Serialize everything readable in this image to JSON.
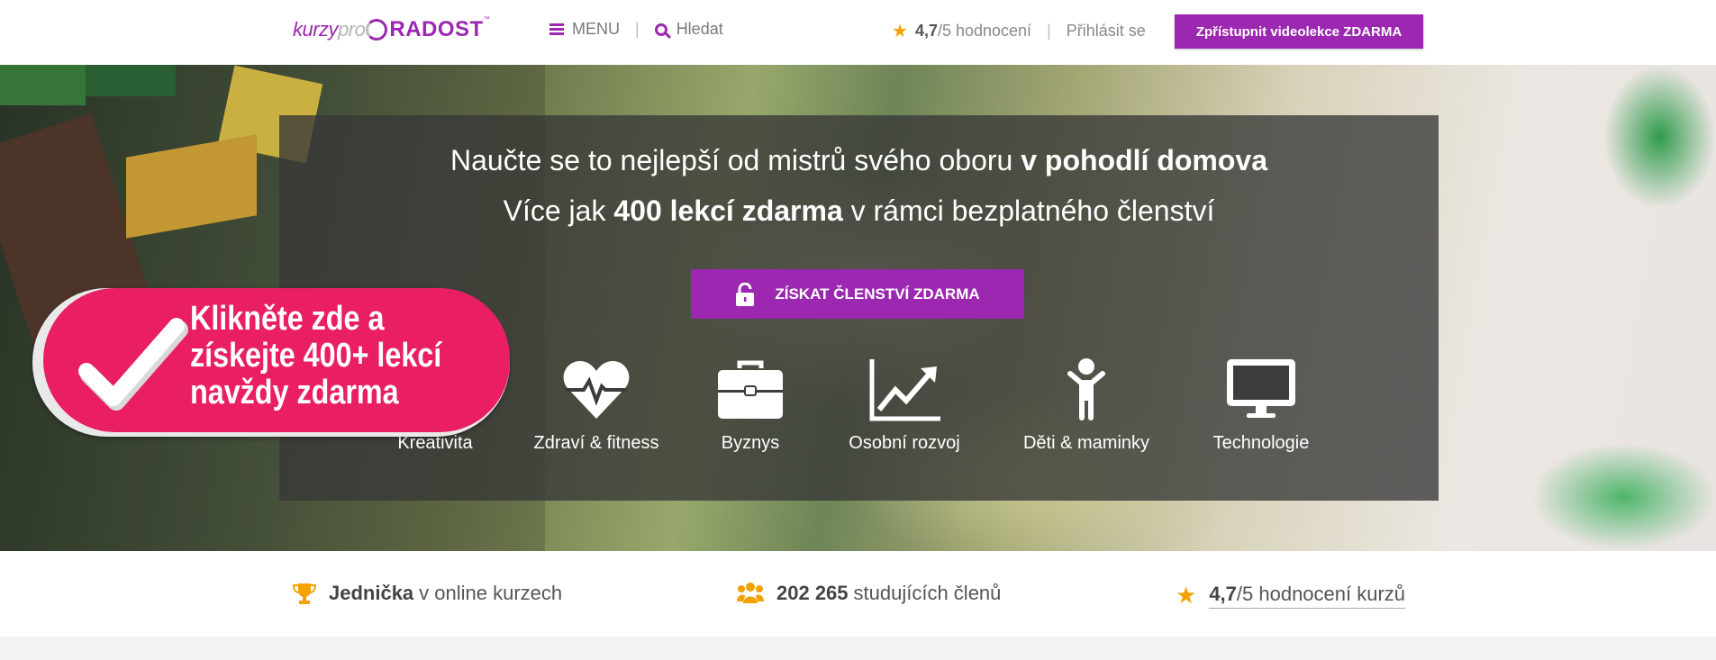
{
  "header": {
    "logo_part1": "kurzy",
    "logo_part2": "pro",
    "logo_part3": "RADOST",
    "logo_tm": "™",
    "menu_label": "MENU",
    "search_label": "Hledat",
    "rating_value": "4,7",
    "rating_suffix": "/5 hodnocení",
    "divider": "|",
    "login_label": "Přihlásit se",
    "cta_label": "Zpřístupnit videolekce ZDARMA"
  },
  "hero": {
    "line1_normal": "Naučte se to nejlepší od mistrů svého oboru ",
    "line1_bold": "v pohodlí domova",
    "line2_pre": "Více jak ",
    "line2_bold": "400 lekcí zdarma",
    "line2_post": " v rámci bezplatného členství",
    "cta_label": "ZÍSKAT ČLENSTVÍ ZDARMA",
    "categories": [
      {
        "label": "Kreativita",
        "icon": "brush-icon"
      },
      {
        "label": "Zdraví & fitness",
        "icon": "heartbeat-icon"
      },
      {
        "label": "Byznys",
        "icon": "briefcase-icon"
      },
      {
        "label": "Osobní rozvoj",
        "icon": "chart-line-icon"
      },
      {
        "label": "Děti & maminky",
        "icon": "child-icon"
      },
      {
        "label": "Technologie",
        "icon": "monitor-icon"
      }
    ]
  },
  "promo": {
    "line1": "Klikněte zde a",
    "line2": "získejte 400+ lekcí",
    "line3": "navždy zdarma"
  },
  "stats": {
    "s1_bold": "Jednička",
    "s1_text": "v online kurzech",
    "s2_bold": "202 265",
    "s2_text": "studujících členů",
    "s3_bold": "4,7",
    "s3_text": "/5 hodnocení kurzů"
  },
  "colors": {
    "brand": "#9c27b0",
    "promo": "#e91e63",
    "star": "#f5a100"
  }
}
